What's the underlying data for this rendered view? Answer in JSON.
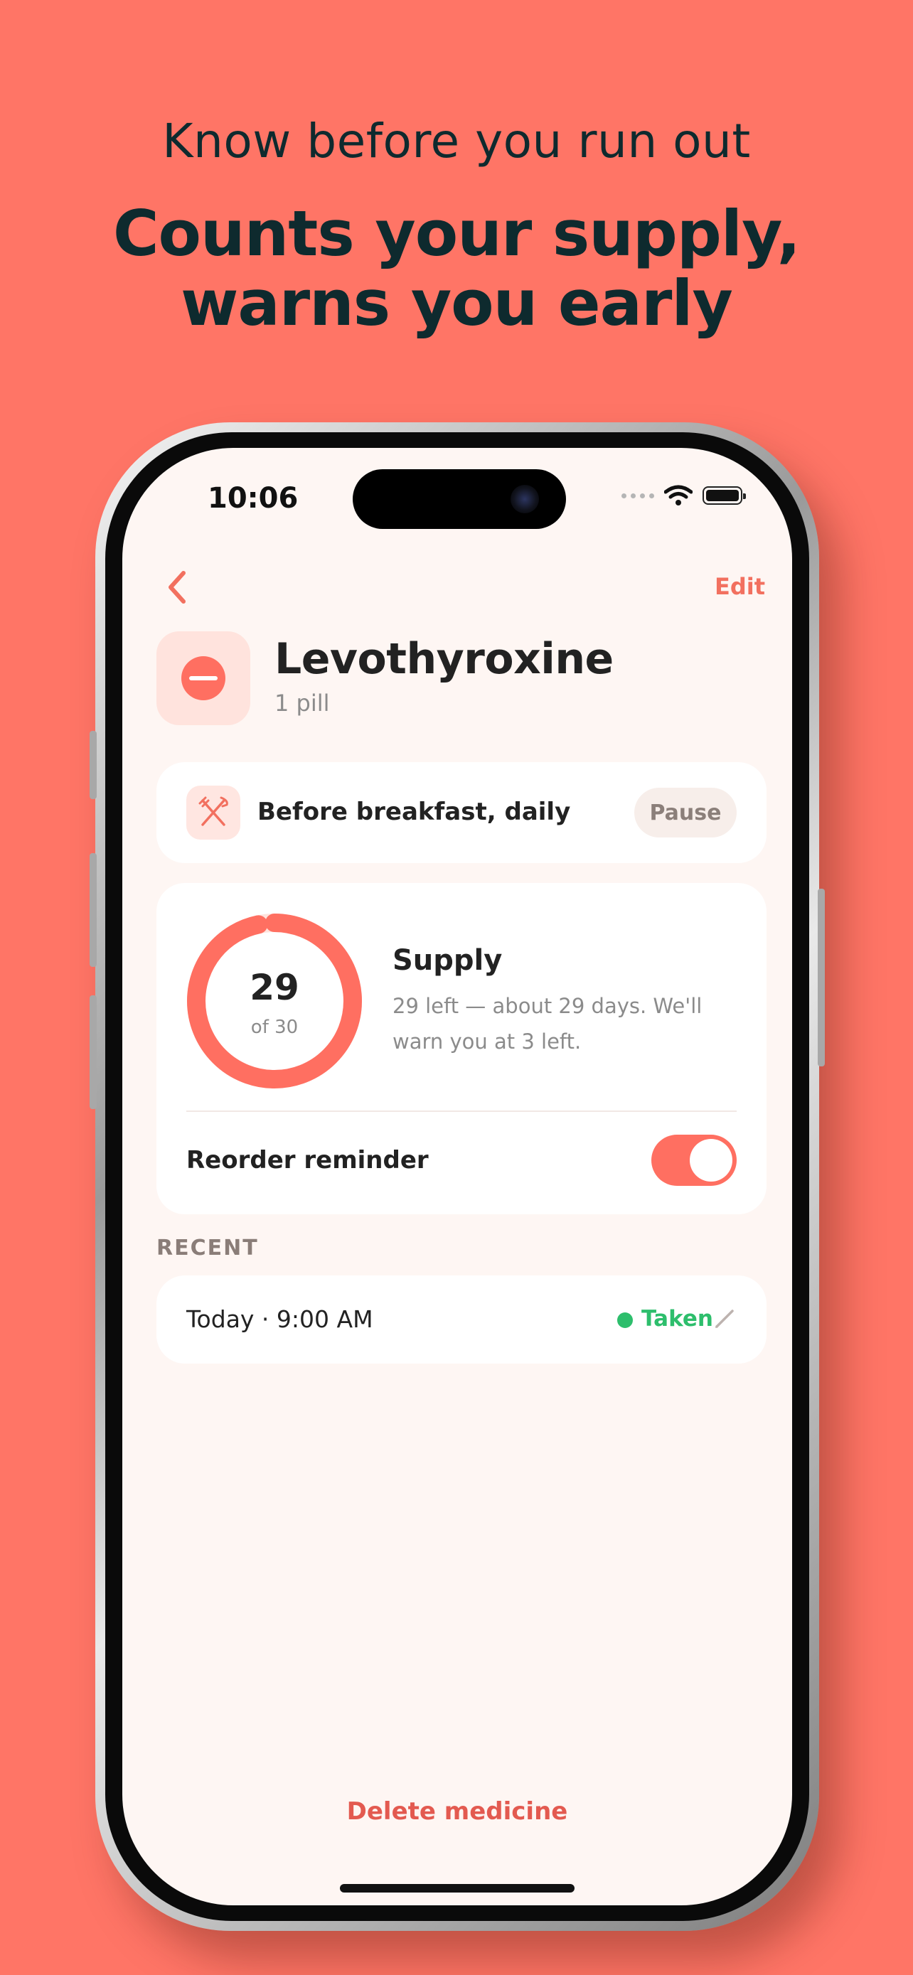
{
  "promo": {
    "subtitle": "Know before you run out",
    "headline_line1": "Counts your supply,",
    "headline_line2": "warns you early"
  },
  "status_bar": {
    "time": "10:06"
  },
  "nav": {
    "edit_label": "Edit"
  },
  "medicine": {
    "name": "Levothyroxine",
    "dose": "1 pill"
  },
  "schedule": {
    "label": "Before breakfast, daily",
    "pause_label": "Pause"
  },
  "supply": {
    "remaining": "29",
    "of_total": "of 30",
    "remaining_value": 29,
    "total_value": 30,
    "title": "Supply",
    "description": "29 left — about 29 days. We'll warn you at 3 left."
  },
  "reorder": {
    "label": "Reorder reminder",
    "enabled": true
  },
  "recent": {
    "section_label": "RECENT",
    "entries": [
      {
        "time": "Today · 9:00 AM",
        "status": "Taken"
      }
    ]
  },
  "delete_label": "Delete medicine",
  "colors": {
    "background": "#FF7566",
    "accent": "#F2705F",
    "taken_green": "#2DBE6C",
    "delete_red": "#E35A50",
    "screen_bg": "#FEF6F3"
  }
}
